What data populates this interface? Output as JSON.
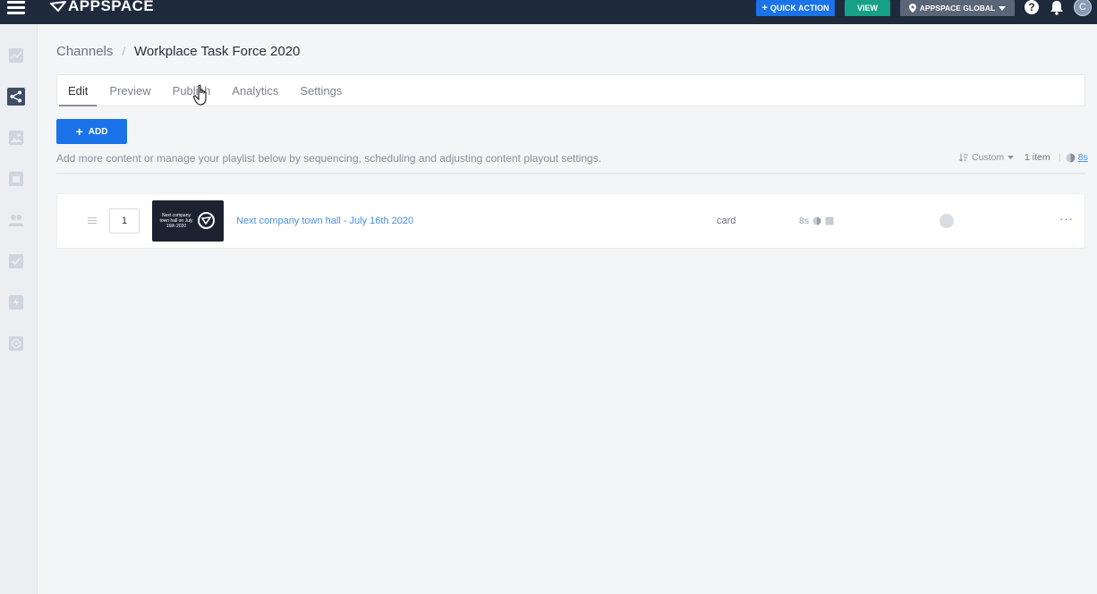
{
  "header": {
    "app_name": "APPSPACE",
    "quick_action_label": "QUICK ACTION",
    "view_label": "VIEW",
    "location_label": "APPSPACE GLOBAL",
    "help_label": "?",
    "avatar_initial": "C"
  },
  "sidebar": {
    "items": [
      {
        "icon": "analytics-icon",
        "active": false
      },
      {
        "icon": "channels-icon",
        "active": true
      },
      {
        "icon": "library-icon",
        "active": false
      },
      {
        "icon": "devices-icon",
        "active": false
      },
      {
        "icon": "users-icon",
        "active": false
      },
      {
        "icon": "tasks-icon",
        "active": false
      },
      {
        "icon": "extensions-icon",
        "active": false
      },
      {
        "icon": "reports-icon",
        "active": false
      }
    ]
  },
  "breadcrumb": {
    "parent": "Channels",
    "separator": "/",
    "current": "Workplace Task Force 2020"
  },
  "tabs": [
    {
      "label": "Edit",
      "active": true
    },
    {
      "label": "Preview",
      "active": false
    },
    {
      "label": "Publish",
      "active": false
    },
    {
      "label": "Analytics",
      "active": false
    },
    {
      "label": "Settings",
      "active": false
    }
  ],
  "toolbar": {
    "add_label": "ADD",
    "add_icon": "+",
    "help_text": "Add more content or manage your playlist below by sequencing, scheduling and adjusting content playout settings.",
    "sort_label": "Custom",
    "item_count": "1 item",
    "total_duration": "8s"
  },
  "playlist": [
    {
      "order": "1",
      "thumbnail_text": "Next company town hall on July 16th 2020",
      "title": "Next company town hall - July 16th 2020",
      "type": "card",
      "duration": "8s",
      "more_label": "···"
    }
  ],
  "colors": {
    "topbar": "#1f2b3d",
    "primary": "#1a73e8",
    "view": "#16a085",
    "link": "#4a8fe0"
  }
}
